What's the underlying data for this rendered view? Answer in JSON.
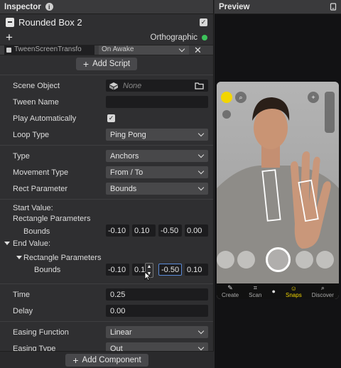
{
  "inspector": {
    "title": "Inspector",
    "object_name": "Rounded Box 2",
    "camera_mode": "Orthographic",
    "script": {
      "name": "TweenScreenTransfo",
      "trigger": "On Awake"
    },
    "add_script": "Add Script",
    "fields": {
      "scene_object": {
        "label": "Scene Object",
        "value": "None"
      },
      "tween_name": {
        "label": "Tween Name",
        "value": ""
      },
      "play_auto": {
        "label": "Play Automatically",
        "checked": true
      },
      "loop_type": {
        "label": "Loop Type",
        "value": "Ping Pong"
      },
      "type": {
        "label": "Type",
        "value": "Anchors"
      },
      "movement_type": {
        "label": "Movement Type",
        "value": "From / To"
      },
      "rect_param": {
        "label": "Rect Parameter",
        "value": "Bounds"
      }
    },
    "start_value": {
      "label": "Start Value:",
      "rect_params": "Rectangle Parameters",
      "bounds_label": "Bounds",
      "values": [
        "-0.10",
        "0.10",
        "-0.50",
        "0.00"
      ]
    },
    "end_value": {
      "label": "End Value:",
      "rect_params": "Rectangle Parameters",
      "bounds_label": "Bounds",
      "values": [
        "-0.10",
        "0.1",
        "-0.50",
        "0.10"
      ]
    },
    "time": {
      "label": "Time",
      "value": "0.25"
    },
    "delay": {
      "label": "Delay",
      "value": "0.00"
    },
    "easing_function": {
      "label": "Easing Function",
      "value": "Linear"
    },
    "easing_type": {
      "label": "Easing Type",
      "value": "Out"
    },
    "add_component": "Add Component"
  },
  "preview": {
    "title": "Preview",
    "bottom_bar": [
      "Create",
      "Scan",
      "",
      "Snaps",
      "Discover"
    ]
  },
  "colors": {
    "accent_blue": "#5a8ad8",
    "status_green": "#3cc25a",
    "panel_bg": "#2f2f31"
  }
}
